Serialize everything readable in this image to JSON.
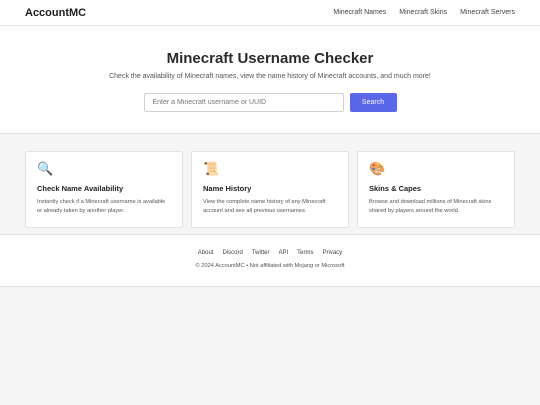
{
  "header": {
    "brand": "AccountMC",
    "nav": [
      "Minecraft Names",
      "Minecraft Skins",
      "Minecraft Servers"
    ]
  },
  "hero": {
    "title": "Minecraft Username Checker",
    "subtitle": "Check the availability of Minecraft names, view the name history of Minecraft accounts, and much more!",
    "search_placeholder": "Enter a Minecraft username or UUID",
    "search_button": "Search"
  },
  "features": [
    {
      "icon": "🔍",
      "icon_name": "magnifier-icon",
      "title": "Check Name Availability",
      "text": "Instantly check if a Minecraft username is available or already taken by another player."
    },
    {
      "icon": "📜",
      "icon_name": "scroll-icon",
      "title": "Name History",
      "text": "View the complete name history of any Minecraft account and see all previous usernames."
    },
    {
      "icon": "🎨",
      "icon_name": "palette-icon",
      "title": "Skins & Capes",
      "text": "Browse and download millions of Minecraft skins shared by players around the world."
    }
  ],
  "footer": {
    "links": [
      "About",
      "Discord",
      "Twitter",
      "API",
      "Terms",
      "Privacy"
    ],
    "copyright": "© 2024 AccountMC • Not affiliated with Mojang or Microsoft"
  },
  "colors": {
    "accent": "#5a67e8",
    "background": "#f5f5f5"
  }
}
